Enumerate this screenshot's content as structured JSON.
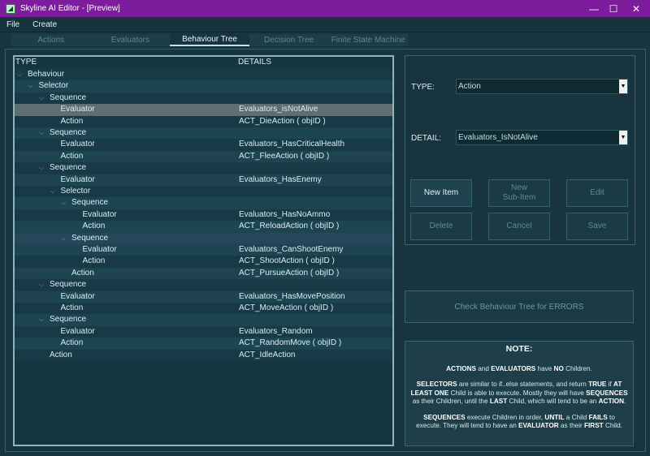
{
  "window": {
    "title": "Skyline AI Editor - [Preview]",
    "minimize": "—",
    "maximize": "☐",
    "close": "✕"
  },
  "menu": [
    "File",
    "Create"
  ],
  "tabs": [
    {
      "label": "Actions",
      "active": false
    },
    {
      "label": "Evaluators",
      "active": false
    },
    {
      "label": "Behaviour Tree",
      "active": true
    },
    {
      "label": "Decision Tree",
      "active": false
    },
    {
      "label": "Finite State Machine",
      "active": false
    }
  ],
  "tree": {
    "headers": {
      "type": "TYPE",
      "details": "DETAILS"
    },
    "rows": [
      {
        "type": "Behaviour",
        "detail": "",
        "level": 0,
        "expander": true,
        "state": ""
      },
      {
        "type": "Selector",
        "detail": "",
        "level": 1,
        "expander": true,
        "state": ""
      },
      {
        "type": "Sequence",
        "detail": "",
        "level": 2,
        "expander": true,
        "state": ""
      },
      {
        "type": "Evaluator",
        "detail": "Evaluators_isNotAlive",
        "level": 3,
        "expander": false,
        "state": "selected"
      },
      {
        "type": "Action",
        "detail": "ACT_DieAction ( objID )",
        "level": 3,
        "expander": false,
        "state": ""
      },
      {
        "type": "Sequence",
        "detail": "",
        "level": 2,
        "expander": true,
        "state": ""
      },
      {
        "type": "Evaluator",
        "detail": "Evaluators_HasCriticalHealth",
        "level": 3,
        "expander": false,
        "state": ""
      },
      {
        "type": "Action",
        "detail": "ACT_FleeAction ( objID )",
        "level": 3,
        "expander": false,
        "state": ""
      },
      {
        "type": "Sequence",
        "detail": "",
        "level": 2,
        "expander": true,
        "state": ""
      },
      {
        "type": "Evaluator",
        "detail": "Evaluators_HasEnemy",
        "level": 3,
        "expander": false,
        "state": ""
      },
      {
        "type": "Selector",
        "detail": "",
        "level": 3,
        "expander": true,
        "state": ""
      },
      {
        "type": "Sequence",
        "detail": "",
        "level": 4,
        "expander": true,
        "state": ""
      },
      {
        "type": "Evaluator",
        "detail": "Evaluators_HasNoAmmo",
        "level": 5,
        "expander": false,
        "state": ""
      },
      {
        "type": "Action",
        "detail": "ACT_ReloadAction ( objID )",
        "level": 5,
        "expander": false,
        "state": ""
      },
      {
        "type": "Sequence",
        "detail": "",
        "level": 4,
        "expander": true,
        "state": "hover"
      },
      {
        "type": "Evaluator",
        "detail": "Evaluators_CanShootEnemy",
        "level": 5,
        "expander": false,
        "state": ""
      },
      {
        "type": "Action",
        "detail": "ACT_ShootAction ( objID )",
        "level": 5,
        "expander": false,
        "state": ""
      },
      {
        "type": "Action",
        "detail": "ACT_PursueAction ( objID )",
        "level": 4,
        "expander": false,
        "state": ""
      },
      {
        "type": "Sequence",
        "detail": "",
        "level": 2,
        "expander": true,
        "state": ""
      },
      {
        "type": "Evaluator",
        "detail": "Evaluators_HasMovePosition",
        "level": 3,
        "expander": false,
        "state": ""
      },
      {
        "type": "Action",
        "detail": "ACT_MoveAction ( objID )",
        "level": 3,
        "expander": false,
        "state": ""
      },
      {
        "type": "Sequence",
        "detail": "",
        "level": 2,
        "expander": true,
        "state": ""
      },
      {
        "type": "Evaluator",
        "detail": "Evaluators_Random",
        "level": 3,
        "expander": false,
        "state": ""
      },
      {
        "type": "Action",
        "detail": "ACT_RandomMove ( objID )",
        "level": 3,
        "expander": false,
        "state": ""
      },
      {
        "type": "Action",
        "detail": "ACT_IdleAction",
        "level": 2,
        "expander": false,
        "state": ""
      }
    ]
  },
  "props": {
    "type_label": "TYPE:",
    "type_value": "Action",
    "detail_label": "DETAIL:",
    "detail_value": "Evaluators_IsNotAlive",
    "buttons": {
      "new_item": "New Item",
      "new_sub_item_line1": "New",
      "new_sub_item_line2": "Sub-Item",
      "edit": "Edit",
      "delete": "Delete",
      "cancel": "Cancel",
      "save": "Save"
    }
  },
  "check_button": "Check Behaviour Tree for ERRORS",
  "note": {
    "title": "NOTE:",
    "p1": [
      {
        "t": "ACTIONS",
        "b": true
      },
      {
        "t": " and ",
        "b": false
      },
      {
        "t": "EVALUATORS",
        "b": true
      },
      {
        "t": " have ",
        "b": false
      },
      {
        "t": "NO",
        "b": true
      },
      {
        "t": " Children.",
        "b": false
      }
    ],
    "p2": [
      {
        "t": "SELECTORS",
        "b": true
      },
      {
        "t": " are similar to if..else statements, and return ",
        "b": false
      },
      {
        "t": "TRUE",
        "b": true
      },
      {
        "t": " if ",
        "b": false
      },
      {
        "t": "AT LEAST ONE",
        "b": true
      },
      {
        "t": " Child is able to execute. Mostly they will have ",
        "b": false
      },
      {
        "t": "SEQUENCES",
        "b": true
      },
      {
        "t": " as their Children, until the ",
        "b": false
      },
      {
        "t": "LAST",
        "b": true
      },
      {
        "t": " Child, which will tend to be an ",
        "b": false
      },
      {
        "t": "ACTION",
        "b": true
      },
      {
        "t": ".",
        "b": false
      }
    ],
    "p3": [
      {
        "t": "SEQUENCES",
        "b": true
      },
      {
        "t": " execute Children in order, ",
        "b": false
      },
      {
        "t": "UNTIL",
        "b": true
      },
      {
        "t": " a Child ",
        "b": false
      },
      {
        "t": "FAILS",
        "b": true
      },
      {
        "t": " to execute. They will tend to have an ",
        "b": false
      },
      {
        "t": "EVALUATOR",
        "b": true
      },
      {
        "t": " as their ",
        "b": false
      },
      {
        "t": "FIRST",
        "b": true
      },
      {
        "t": " Child.",
        "b": false
      }
    ]
  }
}
